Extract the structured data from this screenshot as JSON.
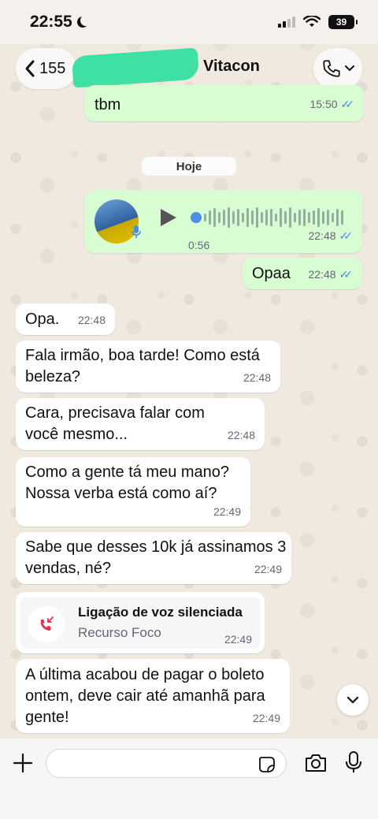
{
  "status_bar": {
    "time": "22:55",
    "battery": "39"
  },
  "header": {
    "back_count": "155",
    "contact_name": "Vitacon"
  },
  "date_chip": "Hoje",
  "messages_out": [
    {
      "text": "tbm",
      "time": "15:50"
    },
    {
      "voice_duration": "0:56",
      "time": "22:48"
    },
    {
      "text": "Opaa",
      "time": "22:48"
    }
  ],
  "messages_in": [
    {
      "text": "Opa.",
      "time": "22:48"
    },
    {
      "text": "Fala irmão, boa tarde! Como está beleza?",
      "time": "22:48"
    },
    {
      "text": "Cara, precisava falar com você mesmo...",
      "time": "22:48"
    },
    {
      "text": "Como a gente tá meu mano? Nossa verba está como aí?",
      "time": "22:49"
    },
    {
      "text": "Sabe que desses 10k já assinamos 3 vendas, né?",
      "time": "22:49"
    },
    {
      "text": "A última acabou de pagar o boleto ontem, deve cair até amanhã para gente!",
      "time": "22:49"
    }
  ],
  "call_card": {
    "title": "Ligação de voz silenciada",
    "subtitle": "Recurso Foco",
    "time": "22:49"
  },
  "input": {
    "value": "",
    "placeholder": ""
  },
  "colors": {
    "outgoing_bubble": "#d9fdd3",
    "incoming_bubble": "#ffffff",
    "read_ticks": "#4a90e2",
    "missed_call": "#e0304e"
  },
  "icons": [
    "back-chevron-icon",
    "phone-icon",
    "chevron-down-icon",
    "play-icon",
    "mic-icon",
    "missed-call-icon",
    "plus-icon",
    "sticker-icon",
    "camera-icon",
    "microphone-icon"
  ]
}
